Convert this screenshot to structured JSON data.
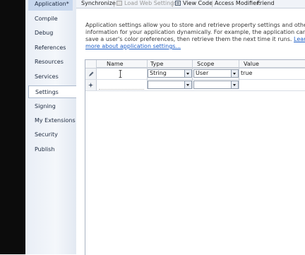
{
  "sidebar": {
    "items": [
      {
        "label": "Application*"
      },
      {
        "label": "Compile"
      },
      {
        "label": "Debug"
      },
      {
        "label": "References"
      },
      {
        "label": "Resources"
      },
      {
        "label": "Services"
      },
      {
        "label": "Settings"
      },
      {
        "label": "Signing"
      },
      {
        "label": "My Extensions"
      },
      {
        "label": "Security"
      },
      {
        "label": "Publish"
      }
    ],
    "selected": "Settings"
  },
  "toolbar": {
    "synchronize": "Synchronize",
    "load_web_settings": "Load Web Settings",
    "view_code": "View Code",
    "access_modifier_label": "Access Modifier:",
    "access_modifier_value": "Friend"
  },
  "description": {
    "text": "Application settings allow you to store and retrieve property settings and other information for your application dynamically. For example, the application can save a user's color preferences, then retrieve them the next time it runs.",
    "link": "Learn more about application settings..."
  },
  "grid": {
    "columns": [
      "Name",
      "Type",
      "Scope",
      "Value"
    ],
    "rows": [
      {
        "name": "",
        "type": "String",
        "scope": "User",
        "value": "true"
      },
      {
        "name": "",
        "type": "",
        "scope": "",
        "value": ""
      }
    ]
  },
  "colors": {
    "link": "#1f5fc7",
    "sidebar_bg": "#eef2f8",
    "selected_bg": "#ffffff"
  }
}
